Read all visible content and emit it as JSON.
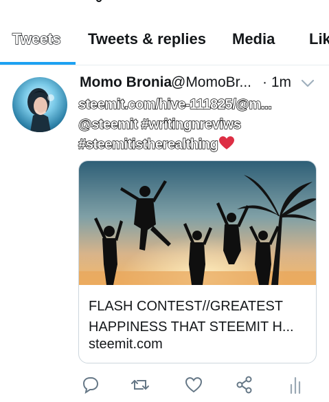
{
  "tabs": [
    {
      "label": "Tweets",
      "active": true
    },
    {
      "label": "Tweets & replies",
      "active": false
    },
    {
      "label": "Media",
      "active": false
    },
    {
      "label": "Lik",
      "active": false
    }
  ],
  "accent_color": "#1da1f2",
  "tweet": {
    "author_name": "Momo Bronia",
    "author_handle": "@MomoBr...",
    "time": "· 1m",
    "text_line1": "steemit.com/hive-111825/@m...",
    "text_line2": "@steemit #writingnreviws",
    "text_line3": "#steemitistherealthing",
    "emoji": "red-heart",
    "card": {
      "title": "FLASH CONTEST//GREATEST HAPPINESS THAT STEEMIT H...",
      "domain": "steemit.com"
    },
    "actions": [
      "reply-icon",
      "retweet-icon",
      "like-icon",
      "share-icon",
      "analytics-icon"
    ]
  }
}
